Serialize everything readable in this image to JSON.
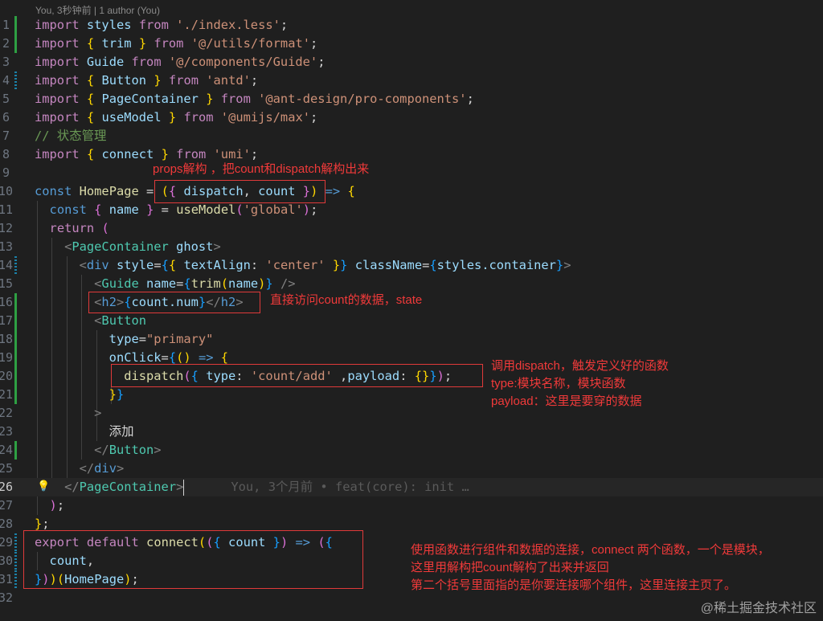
{
  "blame_header": "You, 3秒钟前 | 1 author (You)",
  "inline_blame": "You, 3个月前 • feat(core): init …",
  "line_numbers": [
    "1",
    "2",
    "3",
    "4",
    "5",
    "6",
    "7",
    "8",
    "9",
    "10",
    "11",
    "12",
    "13",
    "14",
    "15",
    "16",
    "17",
    "18",
    "19",
    "20",
    "21",
    "22",
    "23",
    "24",
    "25",
    "26",
    "27",
    "28",
    "29",
    "30",
    "31",
    "32"
  ],
  "code": {
    "l1": {
      "kw": "import",
      "name": "styles",
      "from": "from",
      "src": "'./index.less'",
      "semi": ";"
    },
    "l2": {
      "kw": "import",
      "open": "{",
      "name": "trim",
      "close": "}",
      "from": "from",
      "src": "'@/utils/format'",
      "semi": ";"
    },
    "l3": {
      "kw": "import",
      "name": "Guide",
      "from": "from",
      "src": "'@/components/Guide'",
      "semi": ";"
    },
    "l4": {
      "kw": "import",
      "open": "{",
      "name": "Button",
      "close": "}",
      "from": "from",
      "src": "'antd'",
      "semi": ";"
    },
    "l5": {
      "kw": "import",
      "open": "{",
      "name": "PageContainer",
      "close": "}",
      "from": "from",
      "src": "'@ant-design/pro-components'",
      "semi": ";"
    },
    "l6": {
      "kw": "import",
      "open": "{",
      "name": "useModel",
      "close": "}",
      "from": "from",
      "src": "'@umijs/max'",
      "semi": ";"
    },
    "l7": {
      "comment": "// 状态管理"
    },
    "l8": {
      "kw": "import",
      "open": "{",
      "name": "connect",
      "close": "}",
      "from": "from",
      "src": "'umi'",
      "semi": ";"
    },
    "l10": {
      "kw": "const",
      "name": "HomePage",
      "eq": "=",
      "p_open": "(",
      "b_open": "{",
      "a1": "dispatch",
      "comma": ",",
      "a2": "count",
      "b_close": "}",
      "p_close": ")",
      "arrow": "=>",
      "body_open": "{"
    },
    "l11": {
      "kw": "const",
      "open": "{",
      "name": "name",
      "close": "}",
      "eq": "=",
      "fn": "useModel",
      "p_open": "(",
      "arg": "'global'",
      "p_close": ")",
      "semi": ";"
    },
    "l12": {
      "kw": "return",
      "paren": "("
    },
    "l13": {
      "lt": "<",
      "tag": "PageContainer",
      "attr": "ghost",
      "gt": ">"
    },
    "l14": {
      "lt": "<",
      "tag": "div",
      "attr1": "style",
      "eq1": "=",
      "o1": "{",
      "o2": "{",
      "prop": "textAlign",
      "colon": ":",
      "val": "'center'",
      "c2": "}",
      "c1": "}",
      "attr2": "className",
      "eq2": "=",
      "o3": "{",
      "expr": "styles.container",
      "c3": "}",
      "gt": ">"
    },
    "l15": {
      "lt": "<",
      "tag": "Guide",
      "attr": "name",
      "eq": "=",
      "o": "{",
      "fn": "trim",
      "po": "(",
      "arg": "name",
      "pc": ")",
      "c": "}",
      "end": "/>"
    },
    "l16": {
      "lt": "<",
      "tag": "h2",
      "gt": ">",
      "o": "{",
      "expr": "count.num",
      "c": "}",
      "close_lt": "</",
      "close_tag": "h2",
      "close_gt": ">"
    },
    "l17": {
      "lt": "<",
      "tag": "Button"
    },
    "l18": {
      "attr": "type",
      "eq": "=",
      "val": "\"primary\""
    },
    "l19": {
      "attr": "onClick",
      "eq": "=",
      "o": "{",
      "po": "(",
      "pc": ")",
      "arrow": "=>",
      "bo": "{"
    },
    "l20": {
      "fn": "dispatch",
      "po": "(",
      "bo": "{",
      "k1": "type",
      "colon1": ":",
      "v1": "'count/add'",
      "comma": ",",
      "k2": "payload",
      "colon2": ":",
      "eo": "{",
      "ec": "}",
      "bc": "}",
      "pc": ")",
      "semi": ";"
    },
    "l21": {
      "a": "}",
      "b": "}"
    },
    "l22": {
      "gt": ">"
    },
    "l23": {
      "text": "添加"
    },
    "l24": {
      "lt": "</",
      "tag": "Button",
      "gt": ">"
    },
    "l25": {
      "lt": "</",
      "tag": "div",
      "gt": ">"
    },
    "l26": {
      "lt": "</",
      "tag": "PageContainer",
      "gt": ">"
    },
    "l27": {
      "paren": ")",
      "semi": ";"
    },
    "l28": {
      "brace": "}",
      "semi": ";"
    },
    "l29": {
      "kw1": "export",
      "kw2": "default",
      "fn": "connect",
      "p1": "(",
      "p2": "(",
      "bo": "{",
      "arg": "count",
      "bc": "}",
      "p3": ")",
      "arrow": "=>",
      "p4": "(",
      "bo2": "{"
    },
    "l30": {
      "name": "count",
      "comma": ","
    },
    "l31": {
      "bc": "}",
      "p4": ")",
      "p1": ")",
      "p5": "(",
      "name": "HomePage",
      "p6": ")",
      "semi": ";"
    }
  },
  "annotations": {
    "props": "props解构 ，把count和dispatch解构出来",
    "state": "直接访问count的数据，state",
    "dispatch": "调用dispatch，触发定义好的函数\ntype:模块名称，模块函数\npayload：这里是要穿的数据",
    "connect": "使用函数进行组件和数据的连接，connect 两个函数，一个是模块，\n这里用解构把count解构了出来并返回\n第二个括号里面指的是你要连接哪个组件，这里连接主页了。"
  },
  "watermark": "@稀土掘金技术社区",
  "colors": {
    "annotation": "#e03a3a",
    "background": "#1f1f1f",
    "added_gutter": "#2ea043",
    "modified_gutter": "#1b81a8"
  }
}
